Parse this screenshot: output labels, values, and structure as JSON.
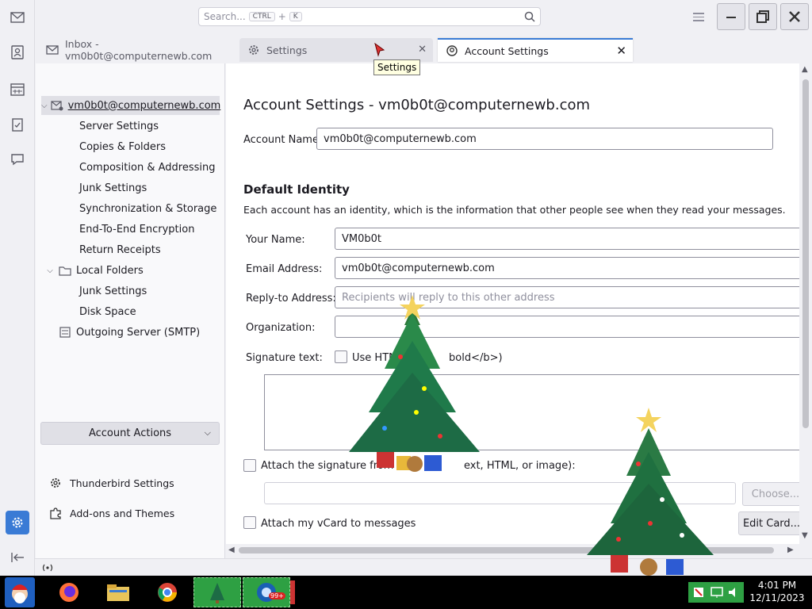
{
  "search": {
    "placeholder": "Search...",
    "key1": "CTRL",
    "plus": "+",
    "key2": "K"
  },
  "tabs": [
    {
      "label": "Inbox - vm0b0t@computernewb.com"
    },
    {
      "label": "Settings"
    },
    {
      "label": "Account Settings"
    }
  ],
  "tooltip": "Settings",
  "tree": {
    "account": "vm0b0t@computernewb.com",
    "account_items": [
      "Server Settings",
      "Copies & Folders",
      "Composition & Addressing",
      "Junk Settings",
      "Synchronization & Storage",
      "End-To-End Encryption",
      "Return Receipts"
    ],
    "local": "Local Folders",
    "local_items": [
      "Junk Settings",
      "Disk Space"
    ],
    "smtp": "Outgoing Server (SMTP)",
    "account_actions": "Account Actions",
    "thunderbird_settings": "Thunderbird Settings",
    "addons": "Add-ons and Themes"
  },
  "main": {
    "title": "Account Settings - vm0b0t@computernewb.com",
    "account_name_label": "Account Name:",
    "account_name_value": "vm0b0t@computernewb.com",
    "default_identity": "Default Identity",
    "identity_desc": "Each account has an identity, which is the information that other people see when they read your messages.",
    "your_name_label": "Your Name:",
    "your_name_value": "VM0b0t",
    "email_label": "Email Address:",
    "email_value": "vm0b0t@computernewb.com",
    "replyto_label": "Reply-to Address:",
    "replyto_placeholder": "Recipients will reply to this other address",
    "org_label": "Organization:",
    "org_value": "",
    "sig_label": "Signature text:",
    "use_html_a": "Use HTM",
    "use_html_b": "bold</b>)",
    "attach_sig_a": "Attach the signature from",
    "attach_sig_b": "ext, HTML, or image):",
    "choose": "Choose...",
    "attach_vcard": "Attach my vCard to messages",
    "edit_card": "Edit Card..."
  },
  "taskbar": {
    "time": "4:01 PM",
    "date": "12/11/2023",
    "badge": "99+"
  },
  "colors": {
    "accent": "#3a7bd5",
    "taskbar_green": "#2ea043"
  }
}
